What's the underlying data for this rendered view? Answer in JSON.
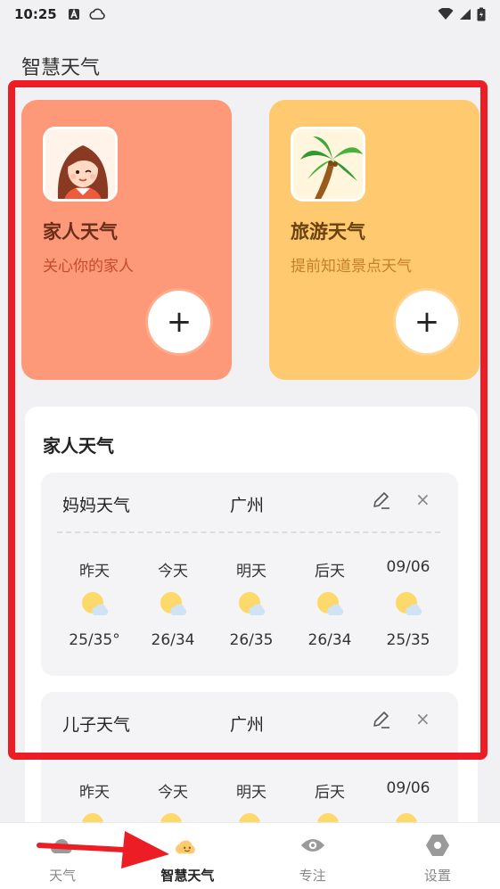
{
  "status_bar": {
    "time": "10:25"
  },
  "page_title": "智慧天气",
  "promos": [
    {
      "title": "家人天气",
      "subtitle": "关心你的家人"
    },
    {
      "title": "旅游天气",
      "subtitle": "提前知道景点天气"
    }
  ],
  "section_title": "家人天气",
  "members": [
    {
      "name": "妈妈天气",
      "city": "广州",
      "days": [
        {
          "label": "昨天",
          "temp": "25/35°"
        },
        {
          "label": "今天",
          "temp": "26/34"
        },
        {
          "label": "明天",
          "temp": "26/35"
        },
        {
          "label": "后天",
          "temp": "26/34"
        },
        {
          "label": "09/06",
          "temp": "25/35"
        }
      ]
    },
    {
      "name": "儿子天气",
      "city": "广州",
      "days": [
        {
          "label": "昨天"
        },
        {
          "label": "今天"
        },
        {
          "label": "明天"
        },
        {
          "label": "后天"
        },
        {
          "label": "09/06"
        }
      ]
    }
  ],
  "tabs": [
    {
      "label": "天气",
      "icon": "weather-icon"
    },
    {
      "label": "智慧天气",
      "icon": "smart-cloud-icon"
    },
    {
      "label": "专注",
      "icon": "eye-icon"
    },
    {
      "label": "设置",
      "icon": "settings-icon"
    }
  ],
  "icons": {
    "close": "×",
    "add": "+"
  },
  "colors": {
    "family_card": "#fd9978",
    "travel_card": "#fec96f",
    "highlight": "#ec1d24",
    "sun": "#fcd96b",
    "cloud": "#cfe3f4"
  }
}
